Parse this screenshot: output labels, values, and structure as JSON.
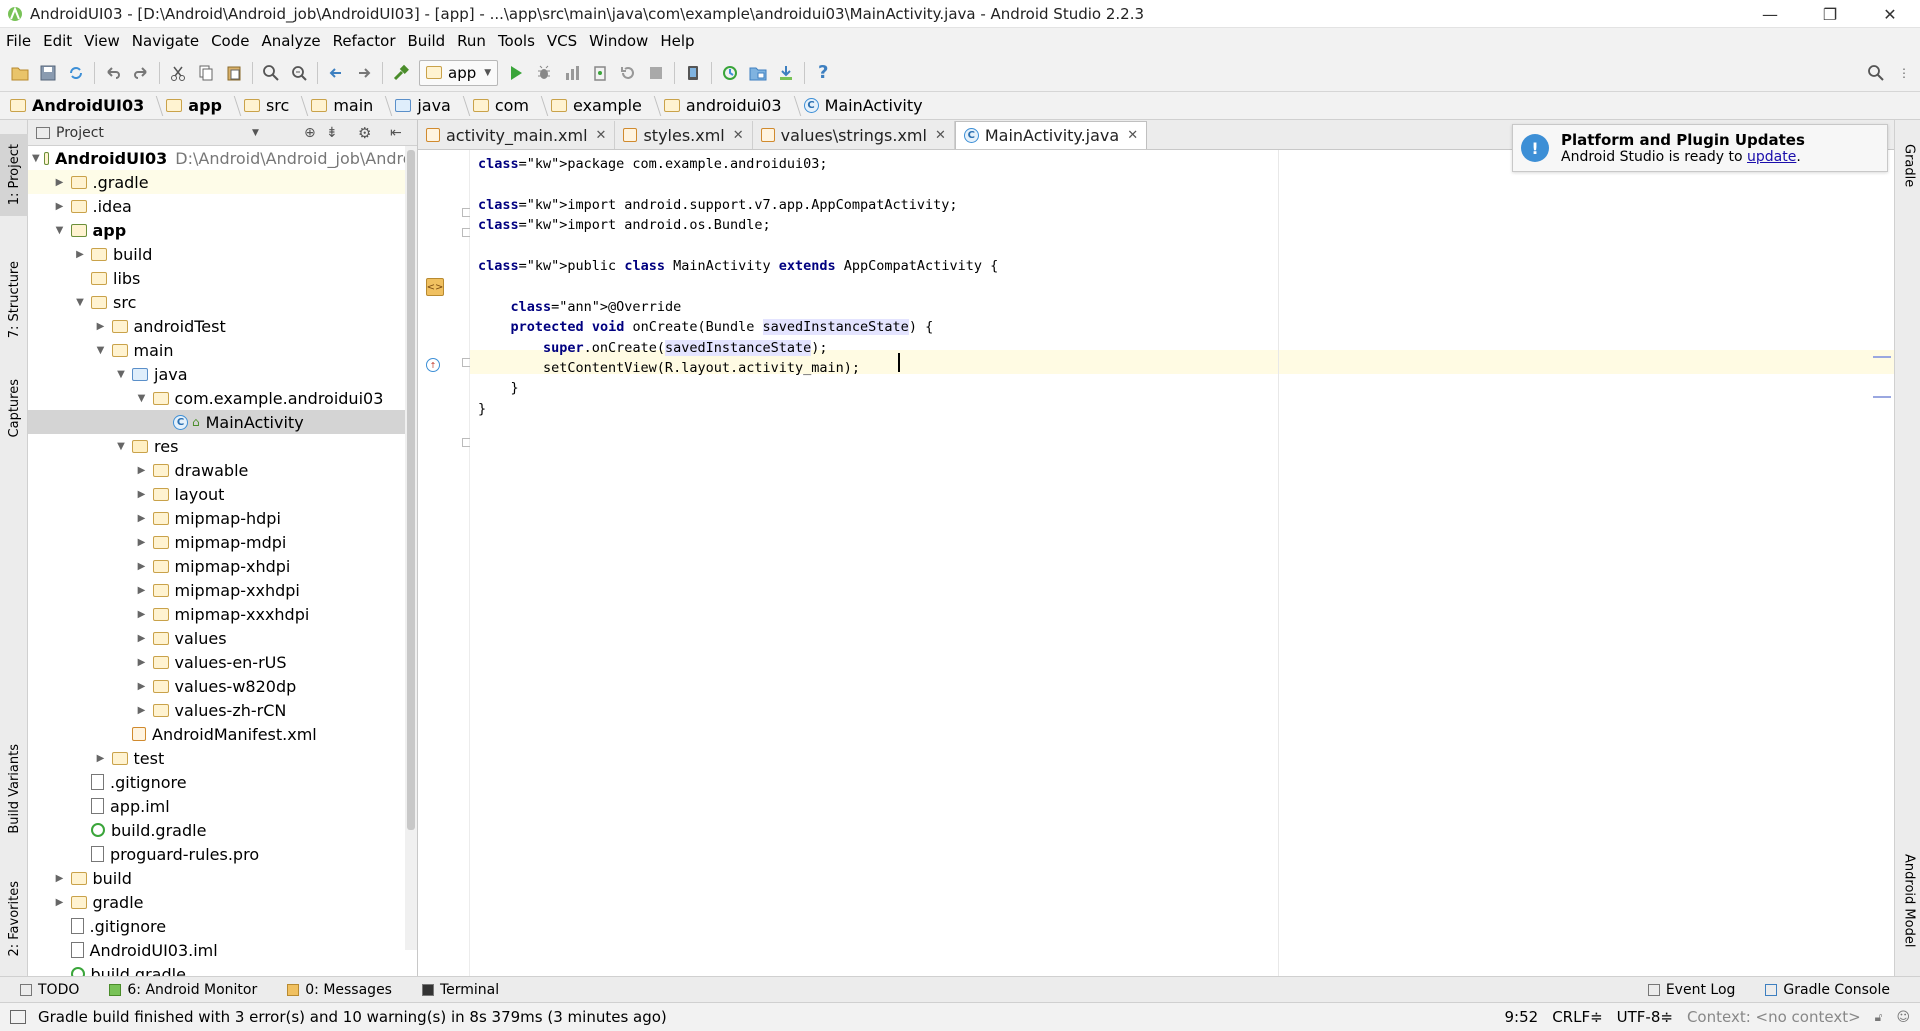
{
  "window": {
    "title": "AndroidUI03 - [D:\\Android\\Android_job\\AndroidUI03] - [app] - ...\\app\\src\\main\\java\\com\\example\\androidui03\\MainActivity.java - Android Studio 2.2.3",
    "minimize": "—",
    "restore": "❐",
    "close": "✕"
  },
  "menu": [
    "File",
    "Edit",
    "View",
    "Navigate",
    "Code",
    "Analyze",
    "Refactor",
    "Build",
    "Run",
    "Tools",
    "VCS",
    "Window",
    "Help"
  ],
  "toolbar": {
    "run_config": "app",
    "help": "?"
  },
  "breadcrumb": [
    "AndroidUI03",
    "app",
    "src",
    "main",
    "java",
    "com",
    "example",
    "androidui03",
    "MainActivity"
  ],
  "side_tabs": {
    "left": [
      "1: Project",
      "7: Structure",
      "Captures",
      "Build Variants",
      "2: Favorites"
    ],
    "right": [
      "Gradle",
      "Android Model"
    ]
  },
  "project": {
    "header": "Project",
    "root_path": "D:\\Android\\Android_job\\Androi",
    "tree": [
      {
        "label": "AndroidUI03",
        "depth": 0,
        "type": "module",
        "arrow": "▼",
        "bold": true
      },
      {
        "label": ".gradle",
        "depth": 1,
        "type": "folder",
        "arrow": "▶",
        "hl": true
      },
      {
        "label": ".idea",
        "depth": 1,
        "type": "folder",
        "arrow": "▶"
      },
      {
        "label": "app",
        "depth": 1,
        "type": "module",
        "arrow": "▼",
        "bold": true
      },
      {
        "label": "build",
        "depth": 2,
        "type": "folder",
        "arrow": "▶"
      },
      {
        "label": "libs",
        "depth": 2,
        "type": "folder",
        "arrow": ""
      },
      {
        "label": "src",
        "depth": 2,
        "type": "folder",
        "arrow": "▼"
      },
      {
        "label": "androidTest",
        "depth": 3,
        "type": "folder",
        "arrow": "▶"
      },
      {
        "label": "main",
        "depth": 3,
        "type": "folder",
        "arrow": "▼"
      },
      {
        "label": "java",
        "depth": 4,
        "type": "folder-blue",
        "arrow": "▼"
      },
      {
        "label": "com.example.androidui03",
        "depth": 5,
        "type": "folder",
        "arrow": "▼"
      },
      {
        "label": "MainActivity",
        "depth": 6,
        "type": "class",
        "arrow": "",
        "sel": true
      },
      {
        "label": "res",
        "depth": 4,
        "type": "folder-res",
        "arrow": "▼"
      },
      {
        "label": "drawable",
        "depth": 5,
        "type": "folder",
        "arrow": "▶"
      },
      {
        "label": "layout",
        "depth": 5,
        "type": "folder",
        "arrow": "▶"
      },
      {
        "label": "mipmap-hdpi",
        "depth": 5,
        "type": "folder",
        "arrow": "▶"
      },
      {
        "label": "mipmap-mdpi",
        "depth": 5,
        "type": "folder",
        "arrow": "▶"
      },
      {
        "label": "mipmap-xhdpi",
        "depth": 5,
        "type": "folder",
        "arrow": "▶"
      },
      {
        "label": "mipmap-xxhdpi",
        "depth": 5,
        "type": "folder",
        "arrow": "▶"
      },
      {
        "label": "mipmap-xxxhdpi",
        "depth": 5,
        "type": "folder",
        "arrow": "▶"
      },
      {
        "label": "values",
        "depth": 5,
        "type": "folder",
        "arrow": "▶"
      },
      {
        "label": "values-en-rUS",
        "depth": 5,
        "type": "folder",
        "arrow": "▶"
      },
      {
        "label": "values-w820dp",
        "depth": 5,
        "type": "folder",
        "arrow": "▶"
      },
      {
        "label": "values-zh-rCN",
        "depth": 5,
        "type": "folder",
        "arrow": "▶"
      },
      {
        "label": "AndroidManifest.xml",
        "depth": 4,
        "type": "manifest",
        "arrow": ""
      },
      {
        "label": "test",
        "depth": 3,
        "type": "folder",
        "arrow": "▶"
      },
      {
        "label": ".gitignore",
        "depth": 2,
        "type": "file",
        "arrow": ""
      },
      {
        "label": "app.iml",
        "depth": 2,
        "type": "file",
        "arrow": ""
      },
      {
        "label": "build.gradle",
        "depth": 2,
        "type": "gradle",
        "arrow": ""
      },
      {
        "label": "proguard-rules.pro",
        "depth": 2,
        "type": "file",
        "arrow": ""
      },
      {
        "label": "build",
        "depth": 1,
        "type": "folder",
        "arrow": "▶"
      },
      {
        "label": "gradle",
        "depth": 1,
        "type": "folder",
        "arrow": "▶"
      },
      {
        "label": ".gitignore",
        "depth": 1,
        "type": "file",
        "arrow": ""
      },
      {
        "label": "AndroidUI03.iml",
        "depth": 1,
        "type": "file",
        "arrow": ""
      },
      {
        "label": "build.gradle",
        "depth": 1,
        "type": "gradle",
        "arrow": ""
      }
    ]
  },
  "tabs": [
    {
      "label": "activity_main.xml",
      "icon": "xml",
      "active": false
    },
    {
      "label": "styles.xml",
      "icon": "xml",
      "active": false
    },
    {
      "label": "values\\strings.xml",
      "icon": "xml",
      "active": false
    },
    {
      "label": "MainActivity.java",
      "icon": "class",
      "active": true
    }
  ],
  "code": [
    "package com.example.androidui03;",
    "",
    "import android.support.v7.app.AppCompatActivity;",
    "import android.os.Bundle;",
    "",
    "public class MainActivity extends AppCompatActivity {",
    "",
    "    @Override",
    "    protected void onCreate(Bundle savedInstanceState) {",
    "        super.onCreate(savedInstanceState);",
    "        setContentView(R.layout.activity_main);",
    "    }",
    "}"
  ],
  "notification": {
    "title": "Platform and Plugin Updates",
    "text": "Android Studio is ready to ",
    "link": "update",
    "suffix": "."
  },
  "bottom_tools": {
    "left": [
      "TODO",
      "6: Android Monitor",
      "0: Messages",
      "Terminal"
    ],
    "right": [
      "Event Log",
      "Gradle Console"
    ]
  },
  "status": {
    "message": "Gradle build finished with 3 error(s) and 10 warning(s) in 8s 379ms (3 minutes ago)",
    "position": "9:52",
    "line_sep": "CRLF≑",
    "encoding": "UTF-8≑",
    "context": "Context: <no context>"
  }
}
